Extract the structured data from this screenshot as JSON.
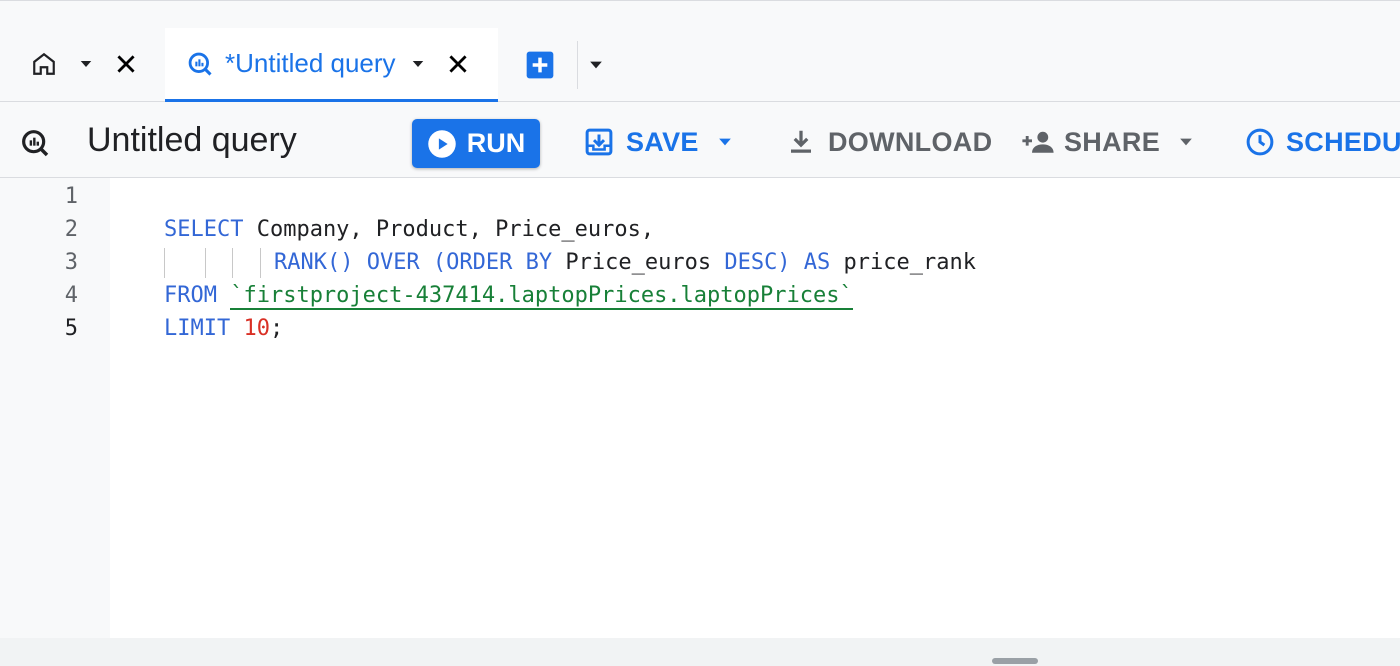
{
  "tabs": {
    "home_icon": "home-icon",
    "query_tab_label": "*Untitled query",
    "query_tab_icon": "query-icon",
    "new_tab_icon": "add-box-icon"
  },
  "toolbar": {
    "query_title": "Untitled query",
    "run_label": "RUN",
    "save_label": "SAVE",
    "download_label": "DOWNLOAD",
    "share_label": "SHARE",
    "schedule_label": "SCHEDUL"
  },
  "editor": {
    "line_numbers": [
      "1",
      "2",
      "3",
      "4",
      "5"
    ],
    "lines": [
      {
        "tokens": [
          {
            "t": "SELECT",
            "c": "kw"
          },
          {
            "t": " Company, Product, Price_euros,",
            "c": "id"
          }
        ]
      },
      {
        "tokens": [
          {
            "t": "RANK() OVER (ORDER BY",
            "c": "kw"
          },
          {
            "t": " Price_euros ",
            "c": "id"
          },
          {
            "t": "DESC) AS",
            "c": "kw"
          },
          {
            "t": " price_rank",
            "c": "id"
          }
        ]
      },
      {
        "tokens": [
          {
            "t": "FROM",
            "c": "kw"
          },
          {
            "t": " ",
            "c": "id"
          },
          {
            "t": "`firstproject-437414.laptopPrices.laptopPrices`",
            "c": "str"
          }
        ]
      },
      {
        "tokens": [
          {
            "t": "LIMIT",
            "c": "kw"
          },
          {
            "t": " ",
            "c": "id"
          },
          {
            "t": "10",
            "c": "num"
          },
          {
            "t": ";",
            "c": "id"
          }
        ]
      },
      {
        "tokens": []
      }
    ]
  },
  "colors": {
    "accent": "#1a73e8",
    "keyword": "#3367d6",
    "string": "#188038",
    "number": "#d93025"
  }
}
